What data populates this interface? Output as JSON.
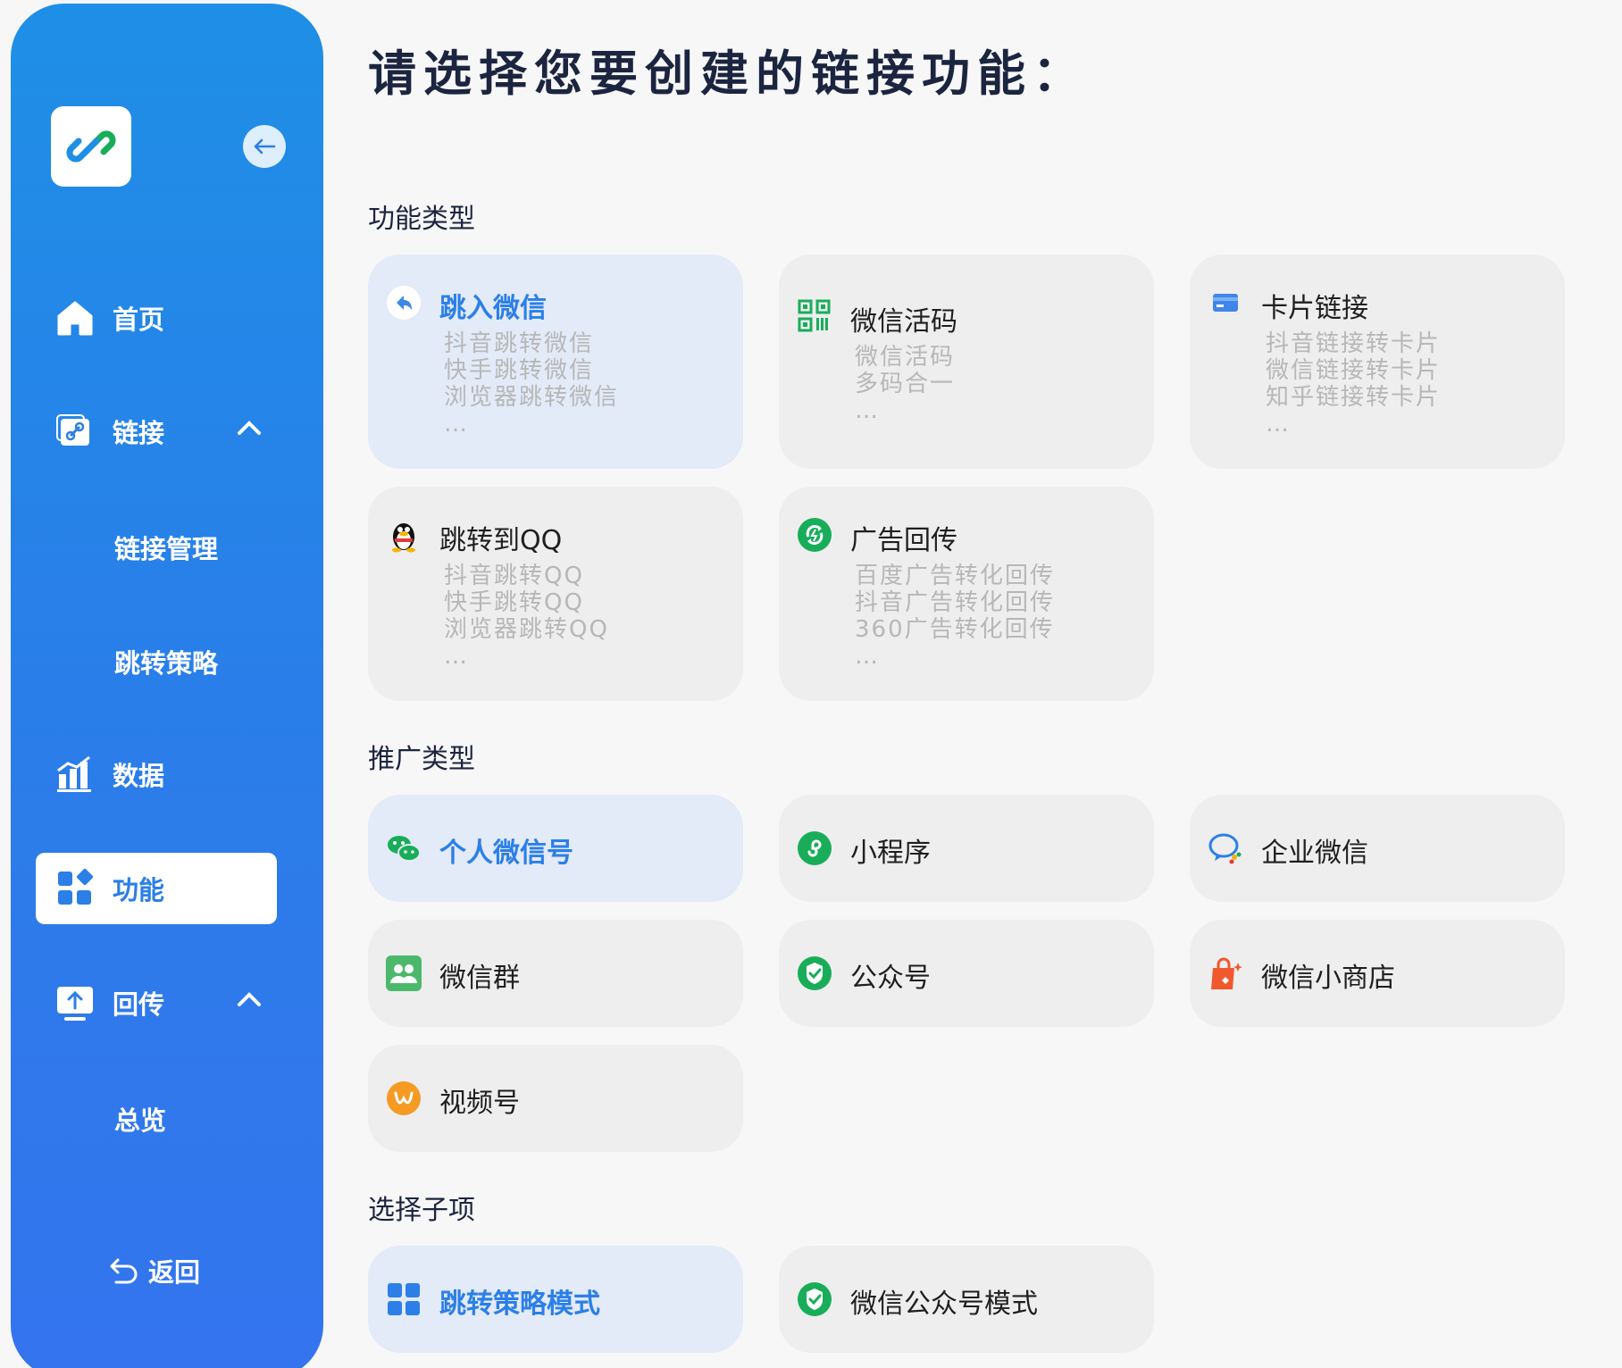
{
  "sidebar": {
    "nav": {
      "home": "首页",
      "links": "链接",
      "link_manage": "链接管理",
      "jump_strategy": "跳转策略",
      "data": "数据",
      "features": "功能",
      "callback": "回传",
      "overview": "总览"
    },
    "back": "返回"
  },
  "main": {
    "title": "请选择您要创建的链接功能：",
    "section_function": "功能类型",
    "section_promo": "推广类型",
    "section_sub": "选择子项",
    "function_cards": [
      {
        "title": "跳入微信",
        "lines": [
          "抖音跳转微信",
          "快手跳转微信",
          "浏览器跳转微信"
        ],
        "more": "…",
        "icon": "share-arrow-icon"
      },
      {
        "title": "微信活码",
        "lines": [
          "微信活码",
          "多码合一"
        ],
        "more": "…",
        "icon": "qrcode-icon"
      },
      {
        "title": "卡片链接",
        "lines": [
          "抖音链接转卡片",
          "微信链接转卡片",
          "知乎链接转卡片"
        ],
        "more": "…",
        "icon": "card-icon"
      },
      {
        "title": "跳转到QQ",
        "lines": [
          "抖音跳转QQ",
          "快手跳转QQ",
          "浏览器跳转QQ"
        ],
        "more": "…",
        "icon": "qq-icon"
      },
      {
        "title": "广告回传",
        "lines": [
          "百度广告转化回传",
          "抖音广告转化回传",
          "360广告转化回传"
        ],
        "more": "…",
        "icon": "refresh-icon"
      }
    ],
    "promo_cards": [
      {
        "title": "个人微信号",
        "icon": "wechat-icon"
      },
      {
        "title": "小程序",
        "icon": "miniprogram-icon"
      },
      {
        "title": "企业微信",
        "icon": "wecom-icon"
      },
      {
        "title": "微信群",
        "icon": "group-icon"
      },
      {
        "title": "公众号",
        "icon": "official-account-icon"
      },
      {
        "title": "微信小商店",
        "icon": "shop-bag-icon"
      },
      {
        "title": "视频号",
        "icon": "channels-icon"
      }
    ],
    "sub_cards": [
      {
        "title": "跳转策略模式",
        "icon": "grid-icon"
      },
      {
        "title": "微信公众号模式",
        "icon": "official-account-icon"
      }
    ]
  },
  "colors": {
    "accent": "#2b7fe7",
    "sidebar_top": "#1e8fe6",
    "sidebar_bottom": "#3474ee",
    "card_bg": "#eeeeee",
    "card_selected": "#e3eaf8",
    "wechat_green": "#19ad5a"
  }
}
